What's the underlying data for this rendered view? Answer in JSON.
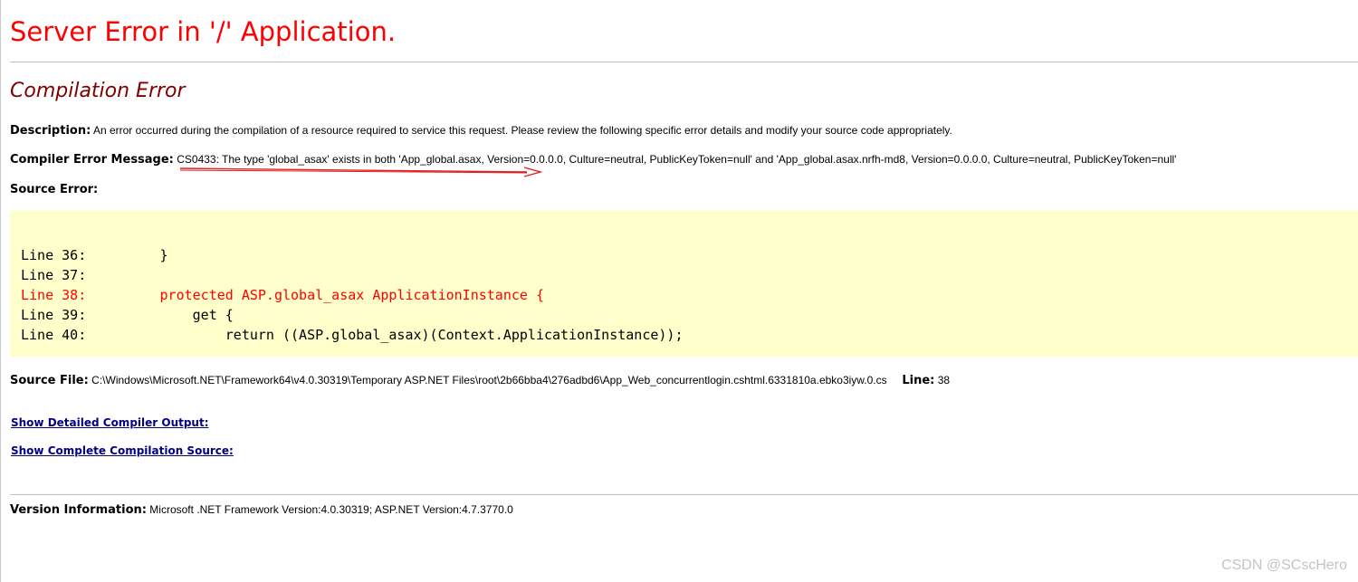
{
  "page": {
    "title": "Server Error in '/' Application.",
    "section_title": "Compilation Error"
  },
  "description": {
    "label": "Description:",
    "text": "An error occurred during the compilation of a resource required to service this request. Please review the following specific error details and modify your source code appropriately."
  },
  "compiler_error": {
    "label": "Compiler Error Message:",
    "text": "CS0433: The type 'global_asax' exists in both 'App_global.asax, Version=0.0.0.0, Culture=neutral, PublicKeyToken=null' and 'App_global.asax.nrfh-md8, Version=0.0.0.0, Culture=neutral, PublicKeyToken=null'"
  },
  "source_error": {
    "label": "Source Error:",
    "lines": [
      {
        "text": "Line 36:         }",
        "is_error": false
      },
      {
        "text": "Line 37:",
        "is_error": false
      },
      {
        "text": "Line 38:         protected ASP.global_asax ApplicationInstance {",
        "is_error": true
      },
      {
        "text": "Line 39:             get {",
        "is_error": false
      },
      {
        "text": "Line 40:                 return ((ASP.global_asax)(Context.ApplicationInstance));",
        "is_error": false
      }
    ]
  },
  "source_file": {
    "label": "Source File:",
    "path": "C:\\Windows\\Microsoft.NET\\Framework64\\v4.0.30319\\Temporary ASP.NET Files\\root\\2b66bba4\\276adbd6\\App_Web_concurrentlogin.cshtml.6331810a.ebko3iyw.0.cs",
    "line_label": "Line:",
    "line_number": "38"
  },
  "links": {
    "detailed_output": "Show Detailed Compiler Output:",
    "complete_source": "Show Complete Compilation Source:"
  },
  "version_info": {
    "label": "Version Information:",
    "text": "Microsoft .NET Framework Version:4.0.30319; ASP.NET Version:4.7.3770.0"
  },
  "watermark": "CSDN @SCscHero",
  "colors": {
    "title": "#ff0000",
    "section_title": "#800000",
    "code_background": "#ffffcc",
    "code_error_line": "#ff0000",
    "link": "#000080",
    "annotation_arrow": "#e02020"
  }
}
